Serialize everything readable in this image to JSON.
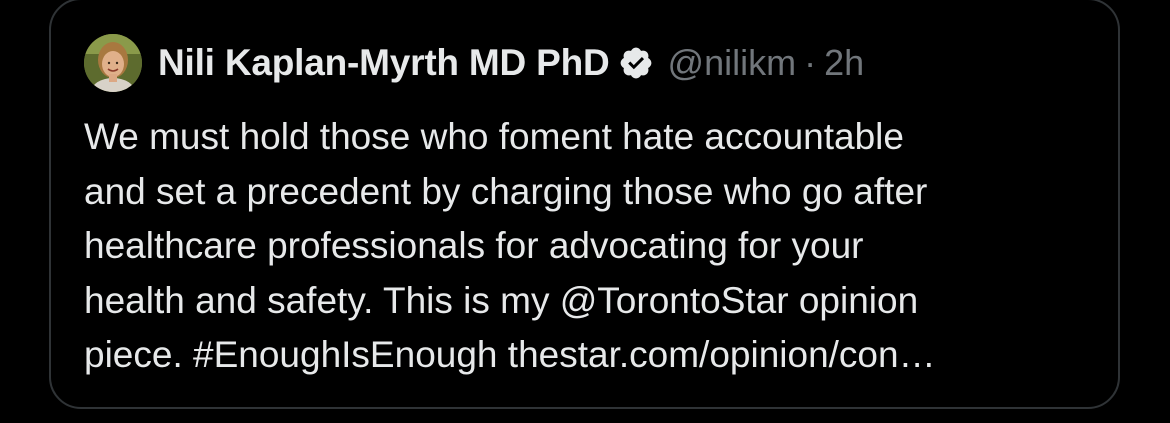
{
  "tweet": {
    "author_name": "Nili Kaplan-Myrth MD PhD",
    "verified": true,
    "handle": "@nilikm",
    "separator": "·",
    "time": "2h",
    "lines": [
      "We must hold those who foment hate accountable",
      "and set a precedent by charging those who go after",
      "healthcare professionals for advocating for your",
      "health and safety. This is my @TorontoStar opinion",
      "piece. #EnoughIsEnough  thestar.com/opinion/con…"
    ]
  },
  "colors": {
    "background": "#000000",
    "border": "#2f3336",
    "text": "#e7e9ea",
    "secondary_text": "#71767b"
  },
  "icons": {
    "verified": "verified-badge-icon",
    "avatar": "profile-photo"
  }
}
